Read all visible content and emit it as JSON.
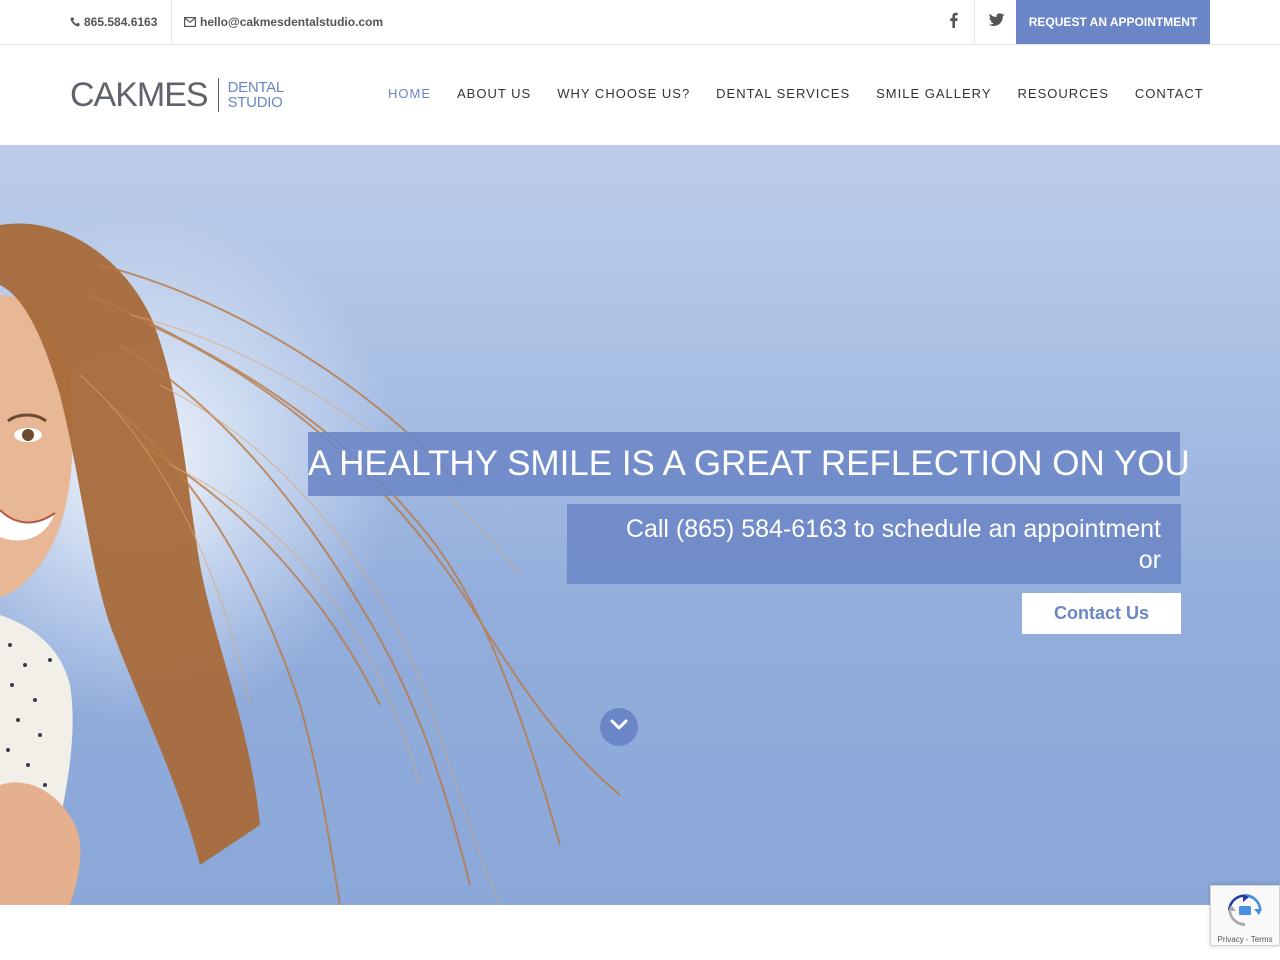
{
  "topbar": {
    "phone": "865.584.6163",
    "email": "hello@cakmesdentalstudio.com",
    "social": [
      "facebook-icon",
      "twitter-icon"
    ],
    "request_label": "REQUEST AN APPOINTMENT"
  },
  "header": {
    "logo": {
      "main": "CAKMES",
      "sub1": "DENTAL",
      "sub2": "STUDIO"
    },
    "nav": [
      {
        "label": "HOME",
        "active": true
      },
      {
        "label": "ABOUT US",
        "active": false
      },
      {
        "label": "WHY CHOOSE US?",
        "active": false
      },
      {
        "label": "DENTAL SERVICES",
        "active": false
      },
      {
        "label": "SMILE GALLERY",
        "active": false
      },
      {
        "label": "RESOURCES",
        "active": false
      },
      {
        "label": "CONTACT",
        "active": false
      }
    ]
  },
  "hero": {
    "headline": "A HEALTHY SMILE IS A GREAT REFLECTION ON YOU",
    "subline_1": "Call (865) 584-6163 to schedule an appointment",
    "subline_2": "or",
    "cta_label": "Contact Us"
  },
  "recaptcha": {
    "terms": "Privacy - Terms"
  },
  "colors": {
    "accent": "#6b86c6",
    "text": "#333333",
    "white": "#ffffff"
  }
}
